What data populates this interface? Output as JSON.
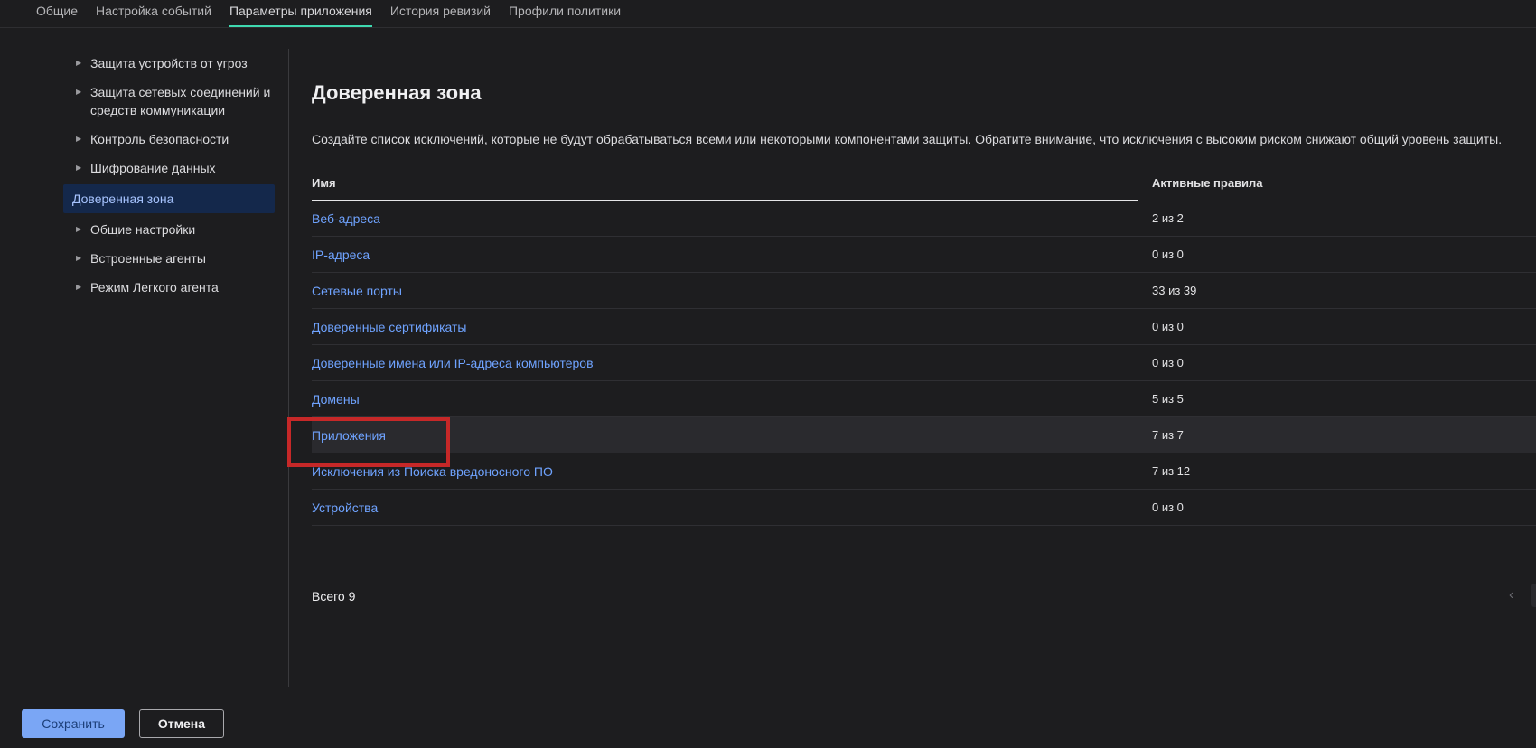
{
  "tabs": [
    {
      "label": "Общие",
      "active": false
    },
    {
      "label": "Настройка событий",
      "active": false
    },
    {
      "label": "Параметры приложения",
      "active": true
    },
    {
      "label": "История ревизий",
      "active": false
    },
    {
      "label": "Профили политики",
      "active": false
    }
  ],
  "sidebar": {
    "items": [
      {
        "label": "Защита устройств от угроз",
        "expandable": true
      },
      {
        "label": "Защита сетевых соединений и средств коммуникации",
        "expandable": true
      },
      {
        "label": "Контроль безопасности",
        "expandable": true
      },
      {
        "label": "Шифрование данных",
        "expandable": true
      },
      {
        "label": "Доверенная зона",
        "expandable": false,
        "active": true
      },
      {
        "label": "Общие настройки",
        "expandable": true
      },
      {
        "label": "Встроенные агенты",
        "expandable": true
      },
      {
        "label": "Режим Легкого агента",
        "expandable": true
      }
    ]
  },
  "main": {
    "title": "Доверенная зона",
    "description": "Создайте список исключений, которые не будут обрабатываться всеми или некоторыми компонентами защиты. Обратите внимание, что исключения с высоким риском снижают общий уровень защиты.",
    "table": {
      "headers": {
        "name": "Имя",
        "rules": "Активные правила"
      },
      "rows": [
        {
          "name": "Веб-адреса",
          "rules": "2 из 2"
        },
        {
          "name": "IP-адреса",
          "rules": "0 из 0"
        },
        {
          "name": "Сетевые порты",
          "rules": "33 из 39"
        },
        {
          "name": "Доверенные сертификаты",
          "rules": "0 из 0"
        },
        {
          "name": "Доверенные имена или IP-адреса компьютеров",
          "rules": "0 из 0"
        },
        {
          "name": "Домены",
          "rules": "5 из 5"
        },
        {
          "name": "Приложения",
          "rules": "7 из 7"
        },
        {
          "name": "Исключения из Поиска вредоносного ПО",
          "rules": "7 из 12"
        },
        {
          "name": "Устройства",
          "rules": "0 из 0"
        }
      ]
    },
    "total": "Всего 9"
  },
  "footer": {
    "save_label": "Сохранить",
    "cancel_label": "Отмена"
  },
  "colors": {
    "background": "#1d1d1f",
    "accent_tab": "#3fd9b0",
    "link": "#6fa3ff",
    "sidebar_active_bg": "#14284b",
    "save_button": "#7aa6f5",
    "highlight_box": "#c62828"
  }
}
